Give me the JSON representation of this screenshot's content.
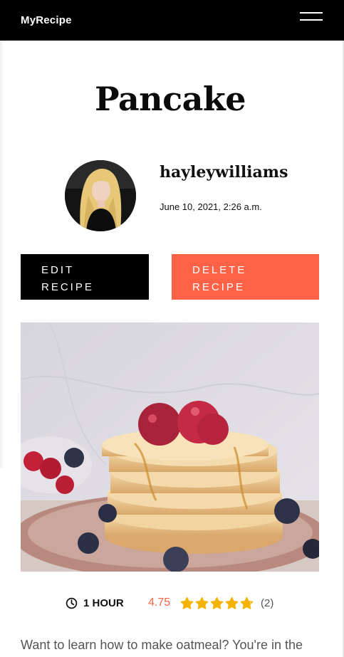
{
  "navbar": {
    "brand": "MyRecipe",
    "menu_icon": "hamburger-menu-icon"
  },
  "recipe": {
    "title": "Pancake",
    "author": {
      "username": "hayleywilliams",
      "published": "June 10, 2021, 2:26 a.m."
    },
    "actions": {
      "edit_label": "EDIT RECIPE",
      "delete_label": "DELETE RECIPE"
    },
    "meta": {
      "duration_icon": "clock-icon",
      "duration": "1 HOUR",
      "rating": 4.75,
      "rating_label": "4.75",
      "rating_count_label": "(2)",
      "stars_max": 5
    },
    "intro": "Want to learn how to make oatmeal? You're in the"
  },
  "colors": {
    "navbar_bg": "#000000",
    "accent": "#ff6347",
    "star": "#f5b301"
  }
}
